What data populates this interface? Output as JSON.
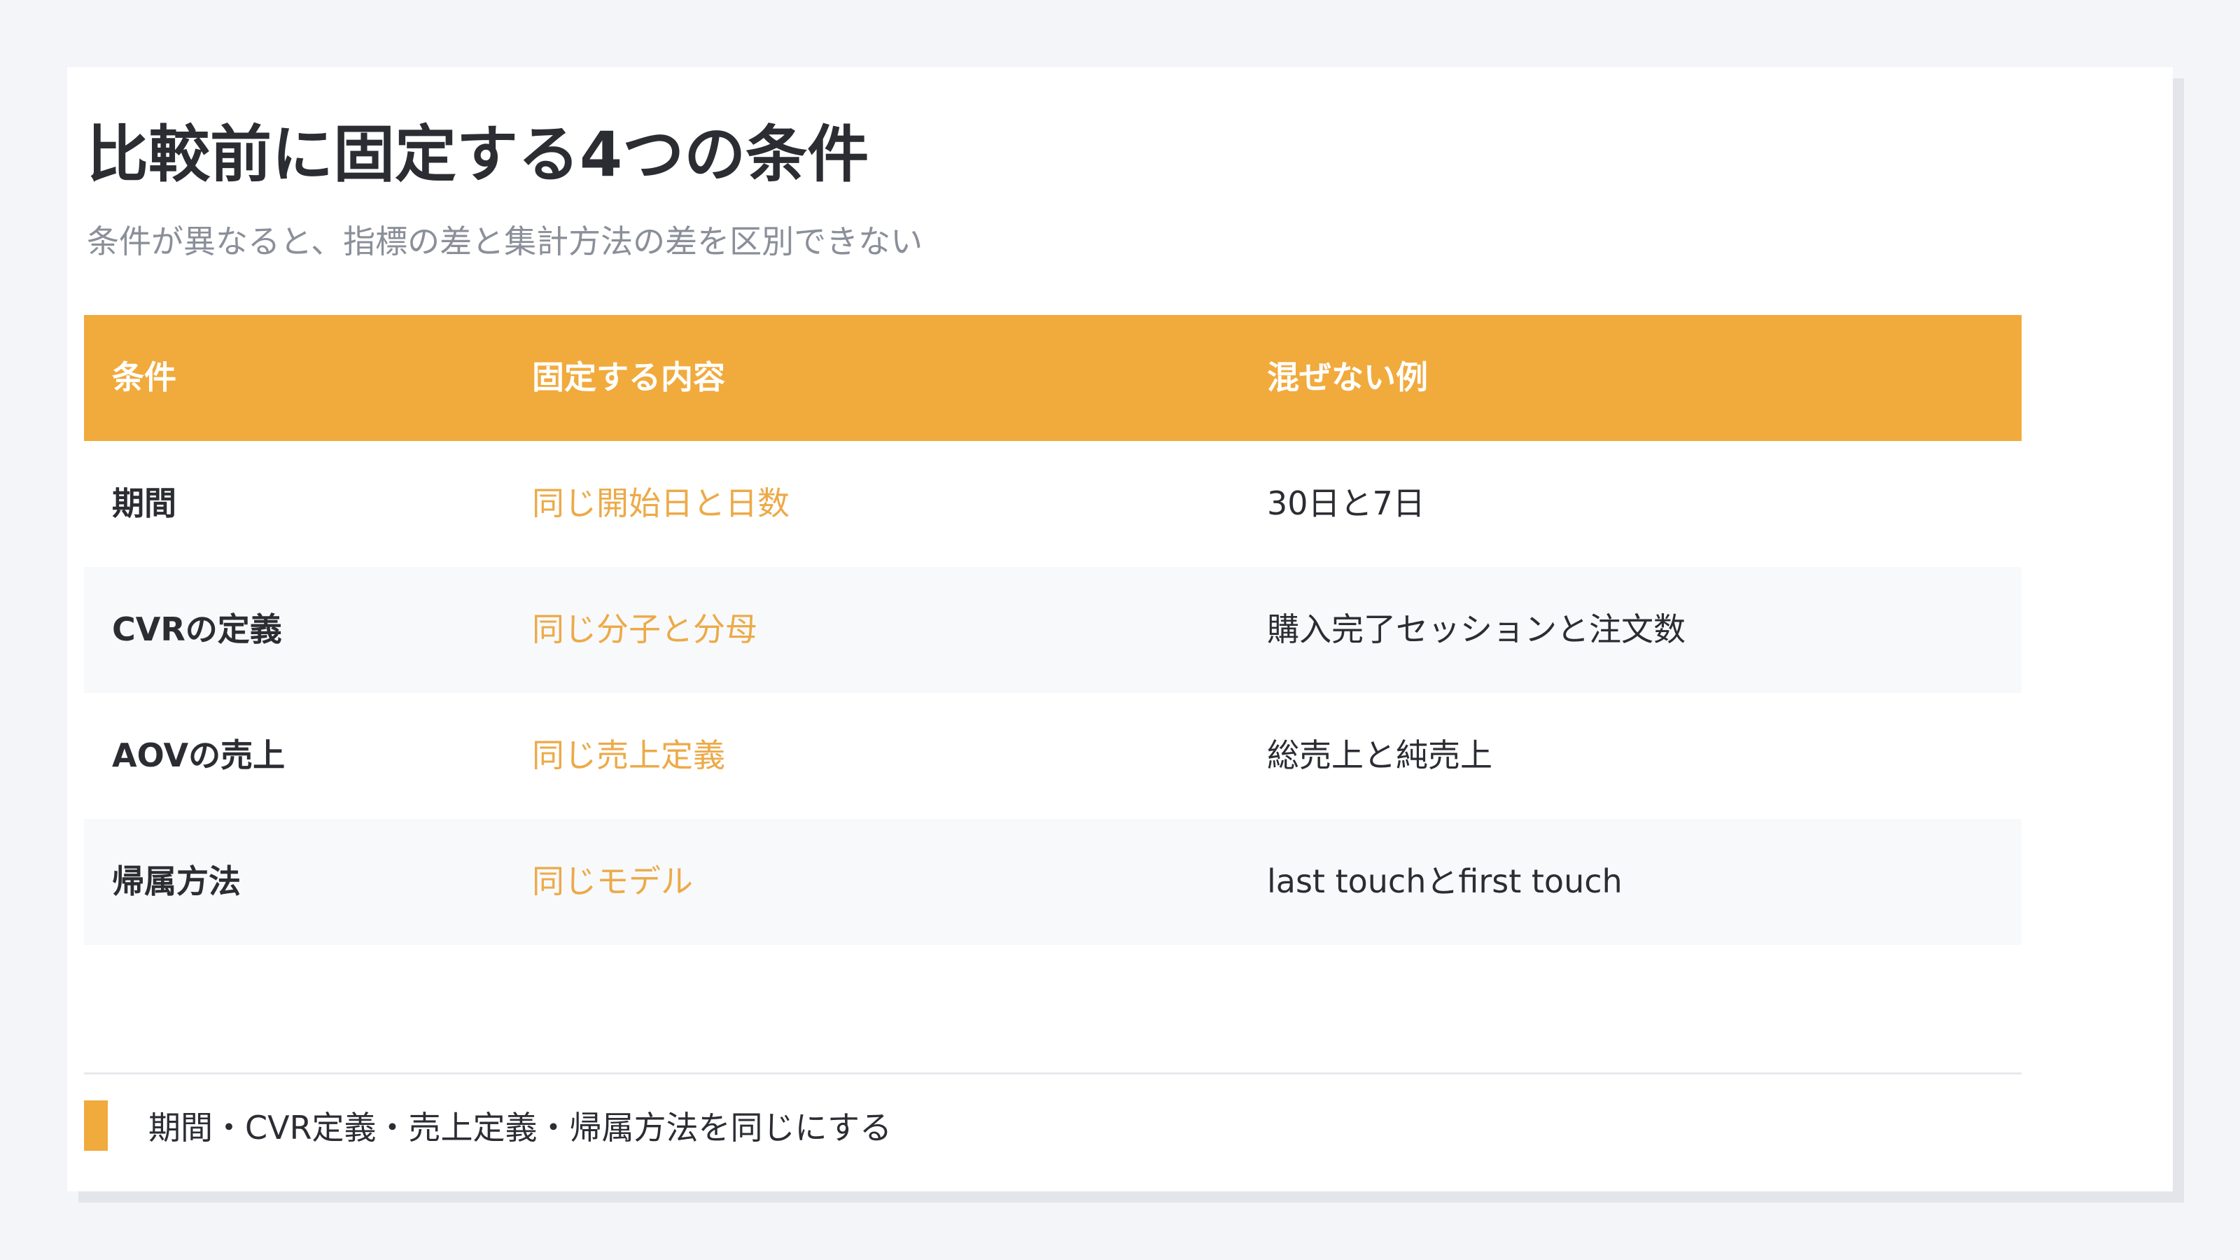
{
  "slide": {
    "title": "比較前に固定する4つの条件",
    "subtitle": "条件が異なると、指標の差と集計方法の差を区別できない"
  },
  "table": {
    "headers": [
      "条件",
      "固定する内容",
      "混ぜない例"
    ],
    "rows": [
      {
        "condition": "期間",
        "fixed": "同じ開始日と日数",
        "example": "30日と7日"
      },
      {
        "condition": "CVRの定義",
        "fixed": "同じ分子と分母",
        "example": "購入完了セッションと注文数"
      },
      {
        "condition": "AOVの売上",
        "fixed": "同じ売上定義",
        "example": "総売上と純売上"
      },
      {
        "condition": "帰属方法",
        "fixed": "同じモデル",
        "example": "last touchとfirst touch"
      }
    ]
  },
  "footnote": {
    "text": "期間・CVR定義・売上定義・帰属方法を同じにする"
  },
  "colors": {
    "accent": "#f1aa3c",
    "title": "#2b2d33",
    "subtitle": "#8a8f99"
  }
}
